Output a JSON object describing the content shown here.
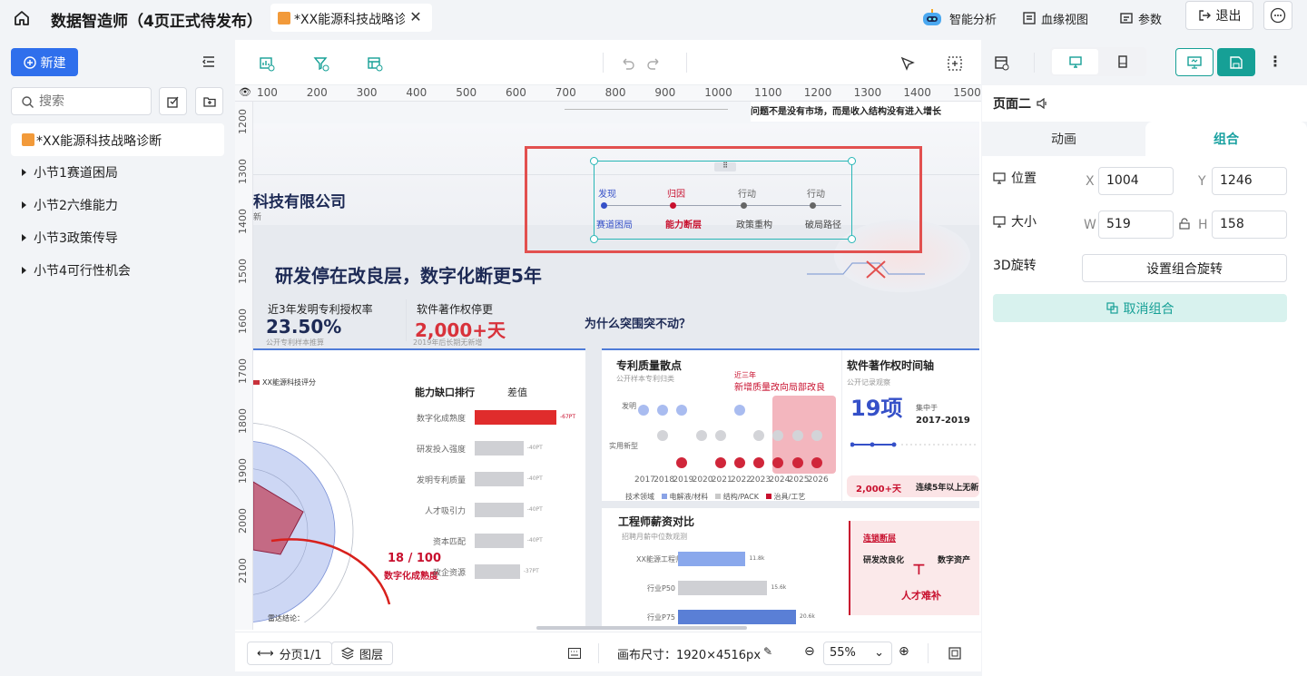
{
  "topbar": {
    "app_title": "数据智造师（4页正式待发布）",
    "tab_title": "*XX能源科技战略诊断",
    "ai_analysis": "智能分析",
    "lineage": "血缘视图",
    "params": "参数",
    "logout": "退出"
  },
  "sidebar": {
    "new_label": "新建",
    "search_placeholder": "搜索",
    "root_item": "*XX能源科技战略诊断",
    "items": [
      {
        "label": "小节1赛道困局"
      },
      {
        "label": "小节2六维能力"
      },
      {
        "label": "小节3政策传导"
      },
      {
        "label": "小节4可行性机会"
      }
    ]
  },
  "ruler": {
    "h_ticks": [
      "100",
      "200",
      "300",
      "400",
      "500",
      "600",
      "700",
      "800",
      "900",
      "1000",
      "1100",
      "1200",
      "1300",
      "1400",
      "1500",
      "1600",
      "1700"
    ],
    "v_ticks": [
      "1200",
      "1300",
      "1400",
      "1500",
      "1600",
      "1700",
      "1800",
      "1900",
      "2000",
      "2100"
    ]
  },
  "canvas": {
    "company": "科技有限公司",
    "company_sub": "新",
    "top_right_note": "问题不是没有市场，而是收入结构没有进入增长",
    "headline": "研发停在改良层，数字化断更5年",
    "kpi1": {
      "label": "近3年发明专利授权率",
      "value": "23.50%",
      "sub": "公开专利样本推算"
    },
    "kpi2": {
      "label": "软件著作权停更",
      "value": "2,000+天",
      "sub": "2019年后长期无新增"
    },
    "question": "为什么突围突不动？",
    "timeline": {
      "tops": [
        "发现",
        "归因",
        "行动",
        "行动"
      ],
      "bottoms": [
        "赛道困局",
        "能力断层",
        "政策重构",
        "破局路径"
      ]
    },
    "gap": {
      "title": "能力缺口排行",
      "col": "差值",
      "rows": [
        {
          "label": "数字化成熟度",
          "value": "-67PT"
        },
        {
          "label": "研发投入强度",
          "value": "-40PT"
        },
        {
          "label": "发明专利质量",
          "value": "-40PT"
        },
        {
          "label": "人才吸引力",
          "value": "-40PT"
        },
        {
          "label": "资本匹配",
          "value": "-40PT"
        },
        {
          "label": "政企资源",
          "value": "-37PT"
        }
      ]
    },
    "radar": {
      "legend": "XX能源科技评分",
      "score": "18 / 100",
      "score_label": "数字化成熟度",
      "conclusion": "雷达结论："
    },
    "patent": {
      "title": "专利质量散点",
      "sub": "公开样本专利归类",
      "note_small": "近三年",
      "note": "新增质量改向局部改良",
      "rows": [
        "发明",
        "实用新型"
      ],
      "years": [
        "2017",
        "2018",
        "2019",
        "2020",
        "2021",
        "2022",
        "2023",
        "2024",
        "2025",
        "2026"
      ],
      "legend": [
        "技术领域",
        "电解液/材料",
        "结构/PACK",
        "治具/工艺"
      ]
    },
    "software": {
      "title": "软件著作权时间轴",
      "sub": "公开记录观察",
      "count": "19项",
      "concentrated": "集中于",
      "range": "2017-2019",
      "banner_value": "2,000+天",
      "banner_text": "连续5年以上无新"
    },
    "salary": {
      "title": "工程师薪资对比",
      "sub": "招聘月薪中位数观测",
      "rows": [
        {
          "label": "XX能源工程师",
          "value": "11.8k"
        },
        {
          "label": "行业P50",
          "value": "15.6k"
        },
        {
          "label": "行业P75",
          "value": "20.6k"
        }
      ]
    },
    "chain": {
      "title": "连锁断层",
      "a": "研发改良化",
      "b": "数字资产",
      "c": "人才难补"
    }
  },
  "bottombar": {
    "page_label": "分页1/1",
    "layers": "图层",
    "canvas_size": "画布尺寸：1920×4516px",
    "zoom": "55%"
  },
  "rpanel": {
    "title": "页面二",
    "tab_anim": "动画",
    "tab_group": "组合",
    "pos_label": "位置",
    "x_label": "X",
    "x_value": "1004",
    "y_label": "Y",
    "y_value": "1246",
    "size_label": "大小",
    "w_label": "W",
    "w_value": "519",
    "h_label": "H",
    "h_value": "158",
    "rot_label": "3D旋转",
    "rot_btn": "设置组合旋转",
    "ungroup": "取消组合"
  },
  "colors": {
    "accent": "#2f6fec",
    "teal": "#16a096",
    "red": "#e2504f"
  },
  "chart_data": [
    {
      "type": "bar",
      "title": "能力缺口排行",
      "categories": [
        "数字化成熟度",
        "研发投入强度",
        "发明专利质量",
        "人才吸引力",
        "资本匹配",
        "政企资源"
      ],
      "values": [
        -67,
        -40,
        -40,
        -40,
        -40,
        -37
      ]
    },
    {
      "type": "bar",
      "title": "工程师薪资对比",
      "categories": [
        "XX能源工程师",
        "行业P50",
        "行业P75"
      ],
      "values": [
        11.8,
        15.6,
        20.6
      ]
    }
  ]
}
